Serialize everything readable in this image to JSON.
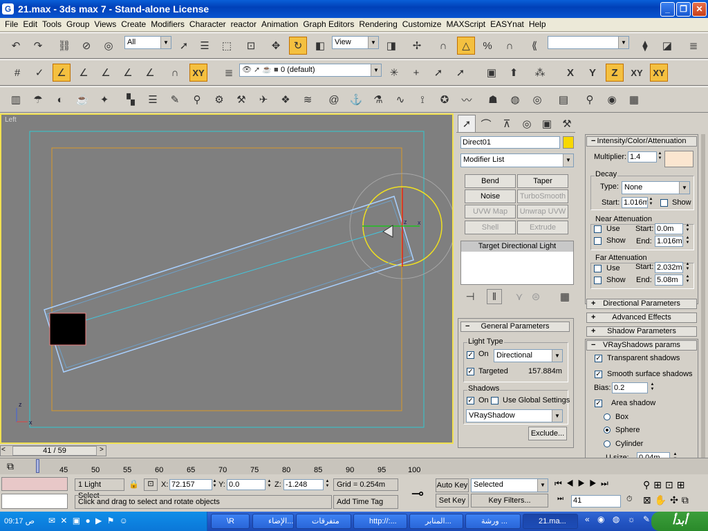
{
  "window": {
    "title": "21.max - 3ds max 7  - Stand-alone License",
    "logo": "G",
    "min": "_",
    "max": "❐",
    "close": "✕"
  },
  "menu": [
    "File",
    "Edit",
    "Tools",
    "Group",
    "Views",
    "Create",
    "Modifiers",
    "Character",
    "reactor",
    "Animation",
    "Graph Editors",
    "Rendering",
    "Customize",
    "MAXScript",
    "EASYnat",
    "Help"
  ],
  "toolbar": {
    "selection_filter": "All",
    "ref_coord": "View",
    "layer": "0 (default)",
    "named_sel": "",
    "axis_x": "X",
    "axis_y": "Y",
    "axis_z": "Z",
    "axis_xy": "XY",
    "axis_xy2": "XY"
  },
  "viewport": {
    "label": "Left",
    "axis_x": "x",
    "axis_z": "z",
    "gizmo_x": "x",
    "gizmo_z": "z"
  },
  "panel": {
    "object_name": "Direct01",
    "object_color": "#f8d800",
    "modifier_list": "Modifier List",
    "mod_buttons": [
      "Bend",
      "Taper",
      "Noise",
      "TurboSmooth",
      "UVW Map",
      "Unwrap UVW",
      "Shell",
      "Extrude"
    ],
    "stack_item": "Target Directional Light",
    "general": {
      "title": "General Parameters",
      "light_type": "Light Type",
      "on": "On",
      "type_value": "Directional",
      "targeted": "Targeted",
      "target_dist": "157.884m",
      "shadows": "Shadows",
      "shadows_on": "On",
      "global": "Use Global Settings",
      "shadow_type": "VRayShadow",
      "exclude": "Exclude..."
    },
    "intensity": {
      "title": "Intensity/Color/Attenuation",
      "multiplier_label": "Multiplier:",
      "multiplier": "1.4",
      "color": "#fbe6d0",
      "decay": "Decay",
      "type_label": "Type:",
      "type_value": "None",
      "start_label": "Start:",
      "start": "1.016m",
      "show": "Show",
      "near": "Near Attenuation",
      "use": "Use",
      "near_start": "0.0m",
      "end_label": "End:",
      "near_end": "1.016m",
      "far": "Far Attenuation",
      "far_start": "2.032m",
      "far_end": "5.08m"
    },
    "rollouts": [
      "Directional Parameters",
      "Advanced Effects",
      "Shadow Parameters"
    ],
    "vray": {
      "title": "VRayShadows params",
      "transparent": "Transparent shadows",
      "smooth": "Smooth surface shadows",
      "bias_label": "Bias:",
      "bias": "0.2",
      "area": "Area shadow",
      "box": "Box",
      "sphere": "Sphere",
      "cylinder": "Cylinder",
      "usize_label": "U size:",
      "usize": "0.04m"
    }
  },
  "timeline": {
    "frame": "41 / 59",
    "ticks": [
      "45",
      "50",
      "55",
      "60",
      "65",
      "70",
      "75",
      "80",
      "85",
      "90",
      "95",
      "100"
    ]
  },
  "status": {
    "selection": "1 Light Select",
    "x_label": "X:",
    "x": "72.157",
    "y_label": "Y:",
    "y": "0.0",
    "z_label": "Z:",
    "z": "-1.248",
    "grid": "Grid = 0.254m",
    "prompt": "Click and drag to select and rotate objects",
    "add_time_tag": "Add Time Tag",
    "auto_key": "Auto Key",
    "set_key": "Set Key",
    "selected": "Selected",
    "key_filters": "Key Filters...",
    "frame": "41"
  },
  "taskbar": {
    "start": "أبدأ",
    "clock": "09:17 ص",
    "tasks": [
      "21.ma...",
      "ورشة ...",
      "المنابر...",
      "http://:...",
      "متفرقات",
      "الإضاء...",
      "\\R"
    ]
  },
  "colors": {
    "accent": "#f4c040",
    "viewport": "#7f7f7f",
    "target_box": "#000000"
  }
}
